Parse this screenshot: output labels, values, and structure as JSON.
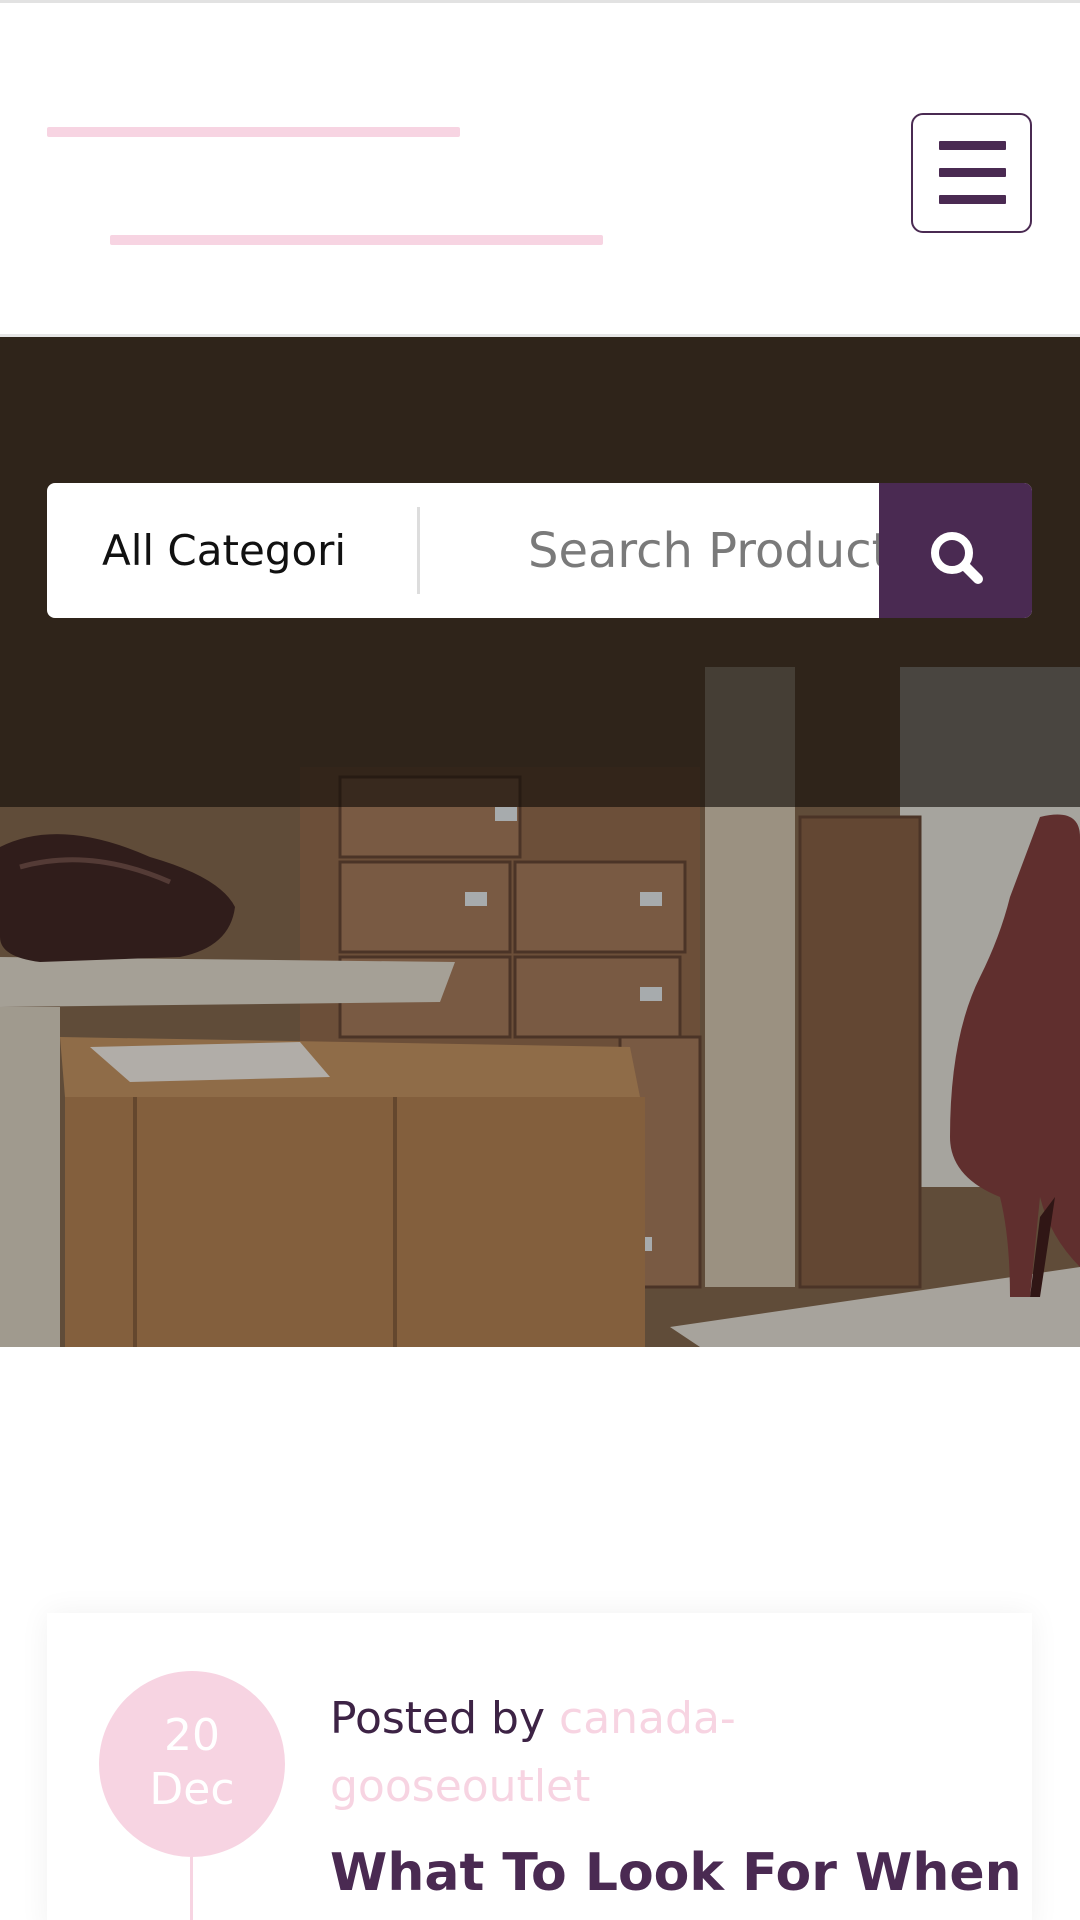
{
  "header": {
    "logo": "site-logo",
    "menu_icon": "hamburger-menu-icon"
  },
  "search": {
    "category_label": "All Categori",
    "placeholder": "Search Products",
    "button_icon": "search-icon"
  },
  "post": {
    "date_day": "20",
    "date_month": "Dec",
    "posted_by_label": "Posted by",
    "author": "canada-gooseoutlet",
    "title": "What To Look For When"
  },
  "colors": {
    "brand_purple": "#4a2a52",
    "accent_pink": "#f7d4e2"
  }
}
